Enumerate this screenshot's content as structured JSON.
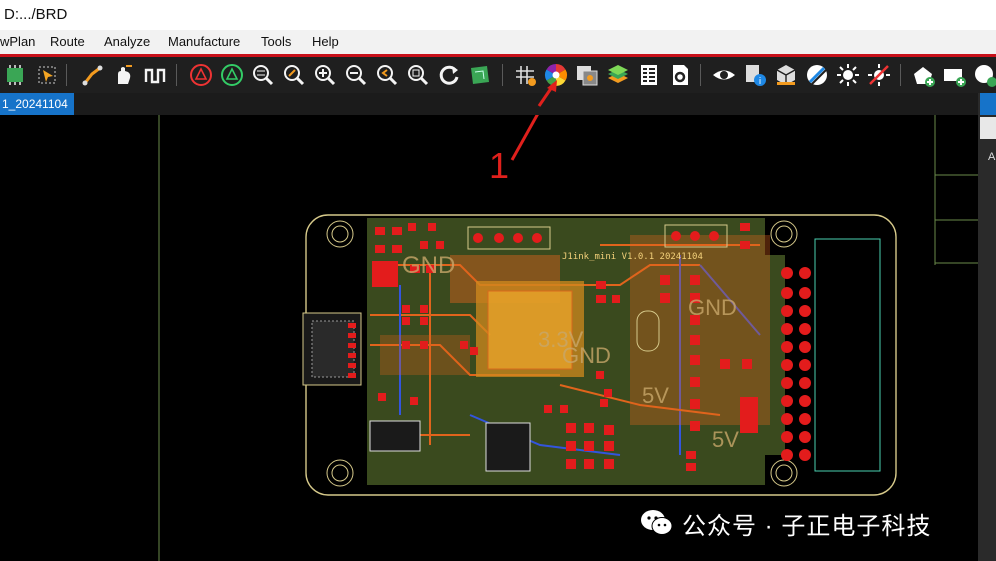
{
  "window": {
    "title": "D:.../BRD"
  },
  "menu": [
    "wPlan",
    "Route",
    "Analyze",
    "Manufacture",
    "Tools",
    "Help"
  ],
  "toolbar": {
    "buttons": [
      "chip-icon",
      "select-cursor-icon",
      "add-connect-icon",
      "slide-hand-icon",
      "delay-tune-icon",
      "unrats-icon",
      "rats-icon",
      "zoom-fit-icon",
      "zoom-points-icon",
      "zoom-in-icon",
      "zoom-out-icon",
      "zoom-previous-icon",
      "zoom-world-icon",
      "redraw-icon",
      "board-icon",
      "grid-toggle-icon",
      "color-wheel-icon",
      "shadow-mode-icon",
      "layers-icon",
      "spreadsheet-icon",
      "setup-icon",
      "visibility-eye-icon",
      "info-icon",
      "3d-view-icon",
      "brush-icon",
      "highlight-sun-icon",
      "dehighlight-sun-icon",
      "add-shape-icon",
      "add-rect-icon",
      "add-circle-icon"
    ]
  },
  "tabs": {
    "active": "1_20241104"
  },
  "annotation": {
    "number": "1"
  },
  "board": {
    "silkscreen": "J1ink_mini V1.0.1 20241104",
    "net_labels": [
      "GND",
      "3.3V",
      "GND",
      "5V",
      "GND",
      "5V"
    ]
  },
  "right_panel": {
    "letter": "A"
  },
  "watermark": {
    "text": "公众号 · 子正电子科技"
  },
  "colors": {
    "accent": "#1673c9",
    "annotation": "#e0201c",
    "board_outline": "#d6c98a",
    "copper": "#e0641c",
    "ground_plane": "#3a4a1e",
    "pad": "#e31c1c"
  }
}
